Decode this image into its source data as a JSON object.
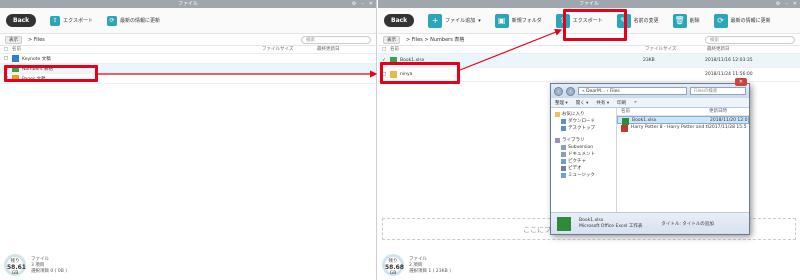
{
  "left": {
    "title": "ファイル",
    "toolbar": {
      "back": "Back",
      "export": "エクスポート",
      "refresh": "最新の情報に更新"
    },
    "path": {
      "display": "表示",
      "crumb": "> Files",
      "search_placeholder": "検索"
    },
    "columns": [
      "名前",
      "ファイルサイズ",
      "最終更新日"
    ],
    "rows": [
      {
        "name": "Keynote 文稿",
        "color": "#2a7fd4"
      },
      {
        "name": "Numbers 表格",
        "color": "#3aa14a"
      },
      {
        "name": "Pages 文稿",
        "color": "#f09a1a"
      }
    ],
    "status": {
      "gauge_top": "残り",
      "gauge_value": "58.61",
      "gauge_unit": "GB",
      "line1": "ファイル",
      "line2": "3 項目",
      "line3": "選択項目 0 ( 0B )"
    }
  },
  "right": {
    "title": "ファイル",
    "toolbar": {
      "back": "Back",
      "add": "ファイル追加",
      "new_folder": "新規フォルダ",
      "export": "エクスポート",
      "rename": "名前の変更",
      "delete": "削除",
      "refresh": "最新の情報に更新"
    },
    "path": {
      "display": "表示",
      "crumb": "> Files > Numbers 表格",
      "search_placeholder": "検索"
    },
    "columns": [
      "名前",
      "ファイルサイズ",
      "最終更新日"
    ],
    "rows": [
      {
        "name": "Book1.xlsx",
        "size": "23KB",
        "date": "2018/11/16 12:03:35"
      },
      {
        "name": "ninya",
        "size": "",
        "date": "2018/11/24 11:56:00"
      }
    ],
    "dropzone": "ここにファイルをドラッグ",
    "status": {
      "gauge_top": "残り",
      "gauge_value": "58.68",
      "gauge_unit": "GB",
      "line1": "ファイル",
      "line2": "2 項目",
      "line3": "選択項目 1 ( 23KB )"
    }
  },
  "explorer": {
    "address": "« DearM... › Files",
    "search_placeholder": "Filesの検索",
    "commands": [
      "整理 ▾",
      "開く ▾",
      "共有 ▾",
      "印刷",
      "»"
    ],
    "nav": [
      {
        "label": "お気に入り",
        "sub": false
      },
      {
        "label": "ダウンロード",
        "sub": true
      },
      {
        "label": "デスクトップ",
        "sub": true
      },
      {
        "label": "ライブラリ",
        "sub": false
      },
      {
        "label": "Subversion",
        "sub": true
      },
      {
        "label": "ドキュメント",
        "sub": true
      },
      {
        "label": "ピクチャ",
        "sub": true
      },
      {
        "label": "ビデオ",
        "sub": true
      },
      {
        "label": "ミュージック",
        "sub": true
      }
    ],
    "list_header": {
      "name": "名前",
      "date": "更新日時"
    },
    "files": [
      {
        "name": "Book1.xlsx",
        "date": "2018/11/20 12:0"
      },
      {
        "name": "Harry Potter 8 - Harry Potter and th...",
        "date": "2017/11/28 15:5"
      }
    ],
    "footer": {
      "file": "Book1.xlsx",
      "type": "Microsoft Office Excel 工作表",
      "title_label": "タイトル: タイトルの追加"
    }
  }
}
